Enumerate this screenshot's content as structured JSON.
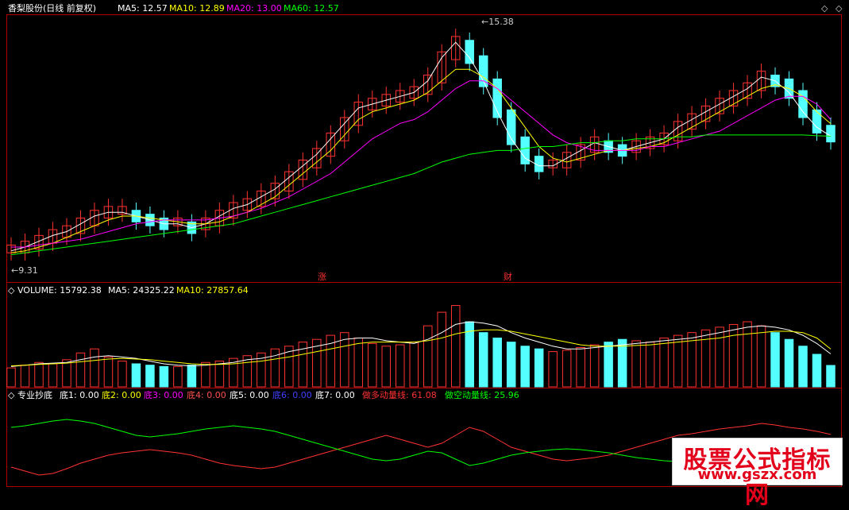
{
  "main_header": {
    "title": "香梨股份(日线 前复权)",
    "ma5": "MA5: 12.57",
    "ma10": "MA10: 12.89",
    "ma20": "MA20: 13.00",
    "ma60": "MA60: 12.57"
  },
  "volume_header": {
    "label": "VOLUME: 15792.38",
    "ma5": "MA5: 24325.22",
    "ma10": "MA10: 27857.64"
  },
  "indicator_header": {
    "name": "专业抄底",
    "d1": "底1: 0.00",
    "d2": "底2: 0.00",
    "d3": "底3: 0.00",
    "d4": "底4: 0.00",
    "d5": "底5: 0.00",
    "d6": "底6: 0.00",
    "d7": "底7: 0.00",
    "long": "做多动量线: 61.08",
    "short": "做空动量线: 25.96"
  },
  "annotations": {
    "high": "15.38",
    "low": "9.31",
    "zhang": "涨",
    "cai": "财"
  },
  "watermark": {
    "line1": "股票公式指标网",
    "line2": "www.gszx.com"
  },
  "colors": {
    "up": "#ff3232",
    "down": "#54ffff",
    "ma5": "#ffffff",
    "ma10": "#ffff00",
    "ma20": "#ff00ff",
    "ma60": "#00ff00",
    "frame": "#b00000"
  },
  "chart_data": [
    {
      "type": "candlestick",
      "title": "香梨股份(日线 前复权)",
      "ylim": [
        9.0,
        15.6
      ],
      "high_label": 15.38,
      "low_label": 9.31,
      "series": [
        {
          "name": "MA5",
          "values": [
            9.6,
            9.7,
            9.85,
            10.0,
            10.1,
            10.3,
            10.5,
            10.6,
            10.6,
            10.5,
            10.4,
            10.3,
            10.3,
            10.2,
            10.3,
            10.5,
            10.7,
            10.8,
            11.0,
            11.2,
            11.5,
            11.8,
            12.1,
            12.5,
            12.9,
            13.3,
            13.4,
            13.5,
            13.6,
            13.7,
            14.0,
            14.6,
            15.0,
            14.6,
            14.0,
            13.2,
            12.5,
            12.0,
            11.8,
            11.8,
            12.0,
            12.2,
            12.4,
            12.3,
            12.2,
            12.3,
            12.4,
            12.5,
            12.8,
            13.0,
            13.2,
            13.4,
            13.6,
            13.8,
            14.1,
            14.0,
            13.7,
            13.2,
            12.8,
            12.57
          ]
        },
        {
          "name": "MA10",
          "values": [
            9.55,
            9.6,
            9.7,
            9.8,
            9.95,
            10.1,
            10.25,
            10.4,
            10.5,
            10.5,
            10.45,
            10.4,
            10.35,
            10.3,
            10.3,
            10.35,
            10.5,
            10.6,
            10.8,
            11.0,
            11.3,
            11.6,
            11.9,
            12.2,
            12.6,
            13.0,
            13.2,
            13.3,
            13.4,
            13.5,
            13.7,
            14.0,
            14.3,
            14.3,
            14.1,
            13.8,
            13.3,
            12.8,
            12.3,
            12.0,
            11.9,
            12.0,
            12.1,
            12.2,
            12.2,
            12.25,
            12.3,
            12.4,
            12.6,
            12.8,
            13.0,
            13.2,
            13.4,
            13.6,
            13.8,
            13.9,
            13.8,
            13.6,
            13.2,
            12.89
          ]
        },
        {
          "name": "MA20",
          "values": [
            9.7,
            9.7,
            9.75,
            9.8,
            9.85,
            9.9,
            10.0,
            10.1,
            10.2,
            10.3,
            10.35,
            10.4,
            10.4,
            10.4,
            10.4,
            10.45,
            10.5,
            10.6,
            10.7,
            10.85,
            11.0,
            11.2,
            11.4,
            11.6,
            11.9,
            12.2,
            12.5,
            12.7,
            12.9,
            13.0,
            13.2,
            13.5,
            13.8,
            14.0,
            14.0,
            13.8,
            13.5,
            13.2,
            12.9,
            12.6,
            12.4,
            12.3,
            12.2,
            12.2,
            12.2,
            12.2,
            12.3,
            12.3,
            12.4,
            12.5,
            12.6,
            12.7,
            12.9,
            13.1,
            13.3,
            13.5,
            13.6,
            13.6,
            13.4,
            13.0
          ]
        },
        {
          "name": "MA60",
          "values": [
            9.5,
            9.55,
            9.6,
            9.65,
            9.7,
            9.75,
            9.8,
            9.85,
            9.9,
            9.95,
            10.0,
            10.05,
            10.1,
            10.15,
            10.2,
            10.25,
            10.3,
            10.4,
            10.5,
            10.6,
            10.7,
            10.8,
            10.9,
            11.0,
            11.1,
            11.2,
            11.3,
            11.4,
            11.5,
            11.6,
            11.75,
            11.9,
            12.0,
            12.1,
            12.15,
            12.2,
            12.2,
            12.25,
            12.3,
            12.3,
            12.35,
            12.4,
            12.4,
            12.45,
            12.45,
            12.5,
            12.5,
            12.5,
            12.55,
            12.55,
            12.6,
            12.6,
            12.6,
            12.6,
            12.6,
            12.6,
            12.6,
            12.6,
            12.58,
            12.57
          ]
        }
      ]
    },
    {
      "type": "bar",
      "title": "VOLUME",
      "values": [
        14000,
        16000,
        18000,
        17000,
        20000,
        25000,
        28000,
        22000,
        19000,
        17000,
        16000,
        15000,
        15000,
        16000,
        18000,
        19000,
        21000,
        23000,
        25000,
        28000,
        30000,
        33000,
        35000,
        38000,
        40000,
        36000,
        32000,
        30000,
        31000,
        33000,
        45000,
        55000,
        60000,
        48000,
        40000,
        36000,
        33000,
        30000,
        28000,
        26000,
        27000,
        29000,
        31000,
        33000,
        35000,
        34000,
        33000,
        36000,
        38000,
        40000,
        42000,
        44000,
        46000,
        48000,
        45000,
        40000,
        35000,
        30000,
        24000,
        15792
      ],
      "series": [
        {
          "name": "MA5",
          "values": [
            15000,
            16000,
            17000,
            17500,
            18000,
            20000,
            22000,
            23000,
            22000,
            21000,
            19000,
            17000,
            16000,
            15500,
            16000,
            17000,
            18000,
            20000,
            21000,
            23000,
            26000,
            28000,
            30000,
            32000,
            35000,
            36000,
            36000,
            34000,
            33000,
            32000,
            35000,
            40000,
            46000,
            48000,
            47000,
            45000,
            40000,
            36000,
            33000,
            30000,
            28000,
            28000,
            29000,
            30000,
            31000,
            32000,
            33000,
            34000,
            35000,
            36000,
            38000,
            40000,
            42000,
            44000,
            45000,
            44000,
            42000,
            38000,
            32000,
            24325
          ]
        },
        {
          "name": "MA10",
          "values": [
            15500,
            16000,
            16500,
            17000,
            17500,
            18500,
            19500,
            20500,
            21000,
            20500,
            20000,
            19000,
            18000,
            17000,
            16500,
            16500,
            17000,
            18000,
            19000,
            20500,
            22000,
            24000,
            26000,
            28000,
            30000,
            32000,
            33000,
            33000,
            33000,
            33000,
            34000,
            36000,
            39000,
            41000,
            42000,
            42000,
            41000,
            39000,
            37000,
            35000,
            33000,
            31000,
            30000,
            30000,
            30000,
            30500,
            31000,
            32000,
            33000,
            34000,
            35000,
            36000,
            38000,
            39000,
            40000,
            41000,
            41000,
            40000,
            36000,
            27857
          ]
        }
      ]
    },
    {
      "type": "line",
      "title": "专业抄底",
      "series": [
        {
          "name": "做多动量线",
          "values": [
            20,
            15,
            10,
            12,
            18,
            25,
            30,
            35,
            38,
            40,
            42,
            40,
            38,
            35,
            30,
            25,
            22,
            20,
            18,
            20,
            25,
            30,
            35,
            40,
            45,
            50,
            55,
            60,
            55,
            50,
            45,
            50,
            60,
            70,
            65,
            55,
            45,
            40,
            35,
            30,
            28,
            30,
            32,
            35,
            40,
            45,
            50,
            55,
            60,
            62,
            65,
            68,
            70,
            72,
            75,
            73,
            70,
            68,
            65,
            61.08
          ]
        },
        {
          "name": "做空动量线",
          "values": [
            70,
            72,
            75,
            78,
            80,
            78,
            75,
            70,
            65,
            60,
            58,
            60,
            62,
            65,
            68,
            70,
            72,
            70,
            68,
            65,
            60,
            55,
            50,
            45,
            40,
            35,
            30,
            28,
            30,
            35,
            40,
            38,
            30,
            22,
            25,
            30,
            35,
            38,
            40,
            42,
            43,
            42,
            40,
            38,
            35,
            32,
            30,
            28,
            27,
            26,
            26,
            25,
            25,
            26,
            27,
            27,
            26,
            26,
            26,
            25.96
          ]
        }
      ]
    }
  ]
}
